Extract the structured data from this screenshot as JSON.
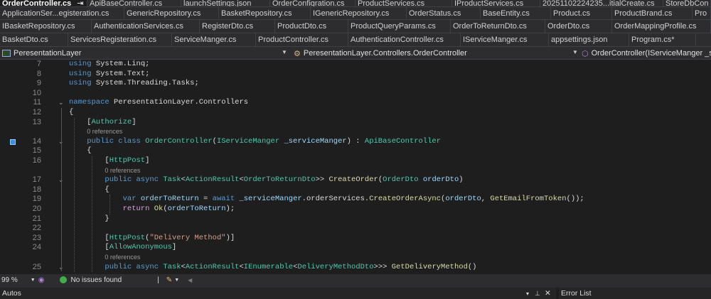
{
  "tabs": {
    "row0": [
      "OrderController.cs",
      "ApiBaseController.cs",
      "launchSettings.json",
      "OrderConfigration.cs",
      "ProductServices.cs",
      "IProductServices.cs",
      "20251102224235...itialCreate.cs",
      "StoreDbCon"
    ],
    "row1": [
      "ApplicationSer...egisteration.cs",
      "GenericRepository.cs",
      "BasketRepository.cs",
      "IGenericRepository.cs",
      "OrderStatus.cs",
      "BaseEntity.cs",
      "Product.cs",
      "ProductBrand.cs",
      "Pro"
    ],
    "row2": [
      "IBasketRepository.cs",
      "AuthenticationServices.cs",
      "RegisterDto.cs",
      "ProductDto.cs",
      "ProductQueryParams.cs",
      "OrderToReturnDto.cs",
      "OrderDto.cs",
      "OrderMappingProfile.cs"
    ],
    "row3": [
      "BasketDto.cs",
      "ServicesRegisteration.cs",
      "ServiceManger.cs",
      "ProductController.cs",
      "AuthenticationController.cs",
      "IServiceManger.cs",
      "appsettings.json",
      "Program.cs*"
    ]
  },
  "active_tab_icons": {
    "pin": "⇥",
    "close": "✕"
  },
  "nav": {
    "project": "PeresentationLayer",
    "type": "PeresentationLayer.Controllers.OrderController",
    "member": "OrderController(IServiceManger _serviceManger)"
  },
  "code": [
    {
      "n": "7",
      "i": 0,
      "tk": [
        [
          "kw",
          "using"
        ],
        [
          "pl",
          " System.Linq;"
        ]
      ]
    },
    {
      "n": "8",
      "i": 0,
      "tk": [
        [
          "kw",
          "using"
        ],
        [
          "pl",
          " System.Text;"
        ]
      ]
    },
    {
      "n": "9",
      "i": 0,
      "tk": [
        [
          "kw",
          "using"
        ],
        [
          "pl",
          " System.Threading.Tasks;"
        ]
      ]
    },
    {
      "n": "10",
      "i": 0,
      "tk": []
    },
    {
      "n": "11",
      "i": 0,
      "fold": true,
      "tk": [
        [
          "kw",
          "namespace"
        ],
        [
          "pl",
          " PeresentationLayer.Controllers"
        ]
      ]
    },
    {
      "n": "12",
      "i": 0,
      "tk": [
        [
          "pl",
          "{"
        ]
      ]
    },
    {
      "n": "13",
      "i": 4,
      "tk": [
        [
          "pl",
          "["
        ],
        [
          "ty",
          "Authorize"
        ],
        [
          "pl",
          "]"
        ]
      ]
    },
    {
      "lens": "0 references",
      "i": 4
    },
    {
      "n": "14",
      "i": 4,
      "fold": true,
      "gutter": true,
      "tk": [
        [
          "kw",
          "public class "
        ],
        [
          "ty",
          "OrderController"
        ],
        [
          "pl",
          "("
        ],
        [
          "ty",
          "IServiceManger"
        ],
        [
          "pa",
          " _serviceManger"
        ],
        [
          "pl",
          ") : "
        ],
        [
          "ty",
          "ApiBaseController"
        ]
      ]
    },
    {
      "n": "15",
      "i": 4,
      "tk": [
        [
          "pl",
          "{"
        ]
      ]
    },
    {
      "n": "16",
      "i": 8,
      "tk": [
        [
          "pl",
          "["
        ],
        [
          "ty",
          "HttpPost"
        ],
        [
          "pl",
          "]"
        ]
      ]
    },
    {
      "lens": "0 references",
      "i": 8
    },
    {
      "n": "17",
      "i": 8,
      "fold": true,
      "tk": [
        [
          "kw",
          "public async "
        ],
        [
          "ty",
          "Task"
        ],
        [
          "pl",
          "<"
        ],
        [
          "ty",
          "ActionResult"
        ],
        [
          "pl",
          "<"
        ],
        [
          "ty",
          "OrderToReturnDto"
        ],
        [
          "pl",
          ">> "
        ],
        [
          "fn",
          "CreateOrder"
        ],
        [
          "pl",
          "("
        ],
        [
          "ty",
          "OrderDto"
        ],
        [
          "pa",
          " orderDto"
        ],
        [
          "pl",
          ")"
        ]
      ]
    },
    {
      "n": "18",
      "i": 8,
      "tk": [
        [
          "pl",
          "{"
        ]
      ]
    },
    {
      "n": "19",
      "i": 12,
      "tk": [
        [
          "kw",
          "var "
        ],
        [
          "pa",
          "orderToReturn"
        ],
        [
          "pl",
          " = "
        ],
        [
          "kw",
          "await "
        ],
        [
          "pa",
          "_serviceManger"
        ],
        [
          "pl",
          "."
        ],
        [
          "pl",
          "orderServices"
        ],
        [
          "pl",
          "."
        ],
        [
          "fn",
          "CreateOrderAsync"
        ],
        [
          "pl",
          "("
        ],
        [
          "pa",
          "orderDto"
        ],
        [
          "pl",
          ", "
        ],
        [
          "fn",
          "GetEmailFromToken"
        ],
        [
          "pl",
          "());"
        ]
      ]
    },
    {
      "n": "20",
      "i": 12,
      "tk": [
        [
          "ct",
          "return "
        ],
        [
          "fn",
          "Ok"
        ],
        [
          "pl",
          "("
        ],
        [
          "pa",
          "orderToReturn"
        ],
        [
          "pl",
          ");"
        ]
      ]
    },
    {
      "n": "21",
      "i": 8,
      "tk": [
        [
          "pl",
          "}"
        ]
      ]
    },
    {
      "n": "22",
      "i": 0,
      "tk": []
    },
    {
      "n": "23",
      "i": 8,
      "tk": [
        [
          "pl",
          "["
        ],
        [
          "ty",
          "HttpPost"
        ],
        [
          "pl",
          "("
        ],
        [
          "st",
          "\"Delivery Method\""
        ],
        [
          "pl",
          ")]"
        ]
      ]
    },
    {
      "n": "24",
      "i": 8,
      "tk": [
        [
          "pl",
          "["
        ],
        [
          "ty",
          "AllowAnonymous"
        ],
        [
          "pl",
          "]"
        ]
      ]
    },
    {
      "lens": "0 references",
      "i": 8
    },
    {
      "n": "25",
      "i": 8,
      "fold": true,
      "tk": [
        [
          "kw",
          "public async "
        ],
        [
          "ty",
          "Task"
        ],
        [
          "pl",
          "<"
        ],
        [
          "ty",
          "ActionResult"
        ],
        [
          "pl",
          "<"
        ],
        [
          "ty",
          "IEnumerable"
        ],
        [
          "pl",
          "<"
        ],
        [
          "ty",
          "DeliveryMethodDto"
        ],
        [
          "pl",
          ">>> "
        ],
        [
          "fn",
          "GetDeliveryMethod"
        ],
        [
          "pl",
          "()"
        ]
      ]
    }
  ],
  "status": {
    "zoom": "99 %",
    "issues": "No issues found"
  },
  "panels": {
    "left": "Autos",
    "right": "Error List",
    "controls": [
      "▾",
      "📌",
      "✕"
    ]
  }
}
